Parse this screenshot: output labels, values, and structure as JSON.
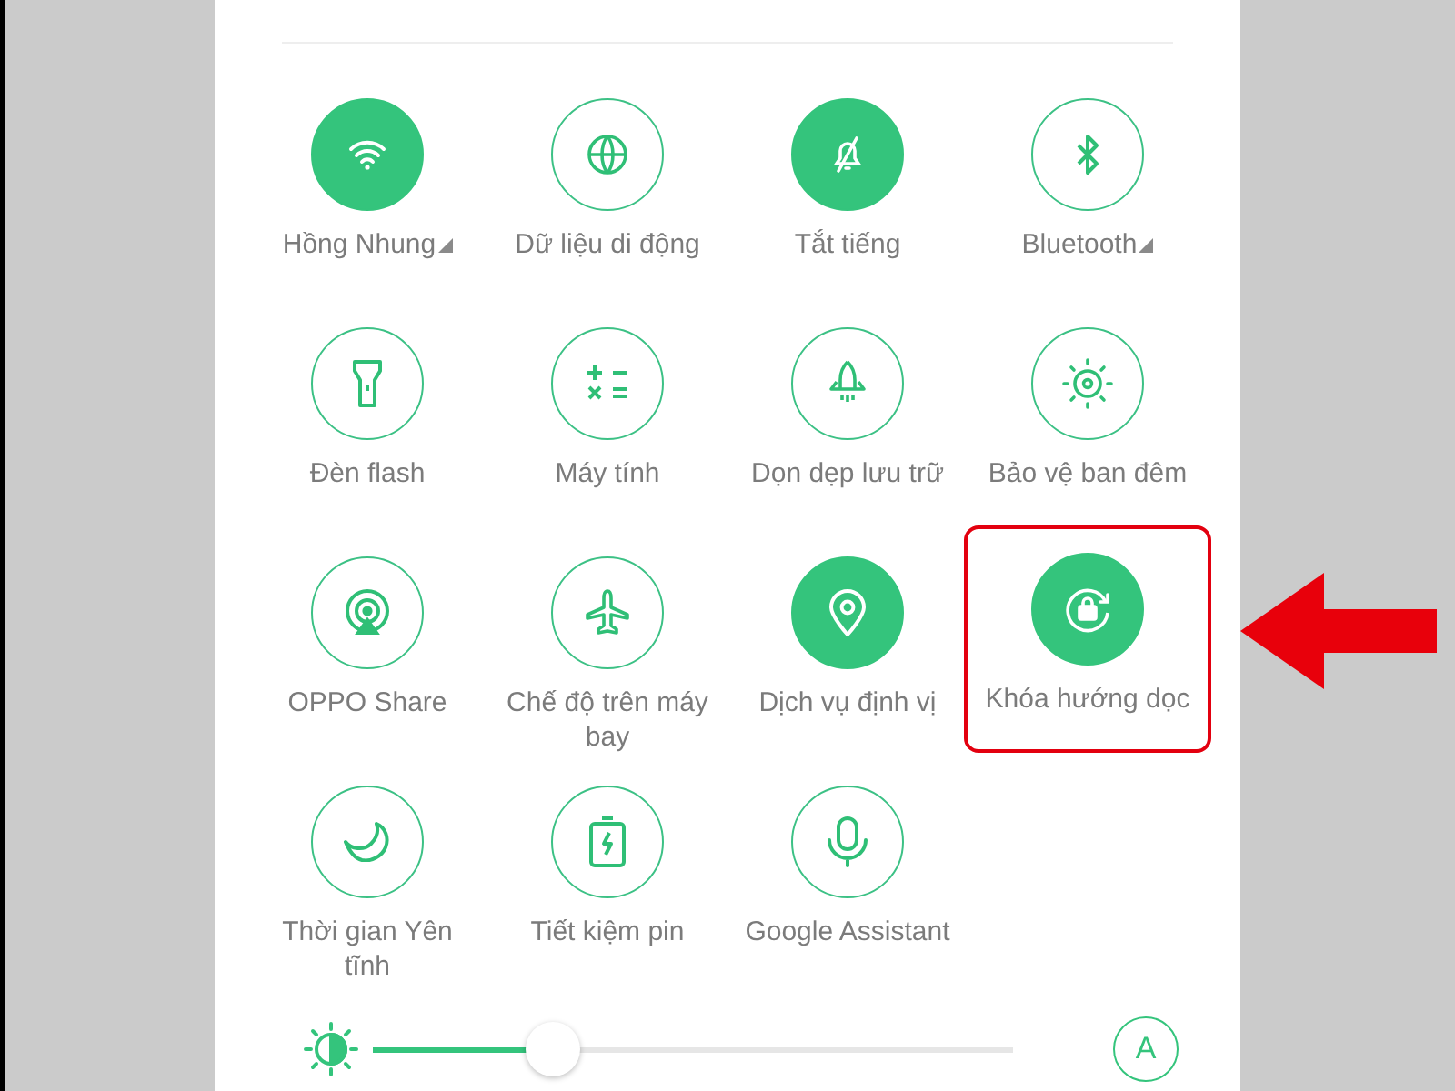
{
  "tiles": [
    {
      "kind": "wifi",
      "label": "Hồng Nhung",
      "on": true,
      "menu": true,
      "highlighted": false
    },
    {
      "kind": "globe",
      "label": "Dữ liệu di động",
      "on": false,
      "menu": false,
      "highlighted": false
    },
    {
      "kind": "mute",
      "label": "Tắt tiếng",
      "on": true,
      "menu": false,
      "highlighted": false
    },
    {
      "kind": "bluetooth",
      "label": "Bluetooth",
      "on": false,
      "menu": true,
      "highlighted": false
    },
    {
      "kind": "flashlight",
      "label": "Đèn flash",
      "on": false,
      "menu": false,
      "highlighted": false
    },
    {
      "kind": "calculator",
      "label": "Máy tính",
      "on": false,
      "menu": false,
      "highlighted": false
    },
    {
      "kind": "rocket",
      "label": "Dọn dẹp lưu trữ",
      "on": false,
      "menu": false,
      "highlighted": false
    },
    {
      "kind": "eye",
      "label": "Bảo vệ ban đêm",
      "on": false,
      "menu": false,
      "highlighted": false
    },
    {
      "kind": "share",
      "label": "OPPO Share",
      "on": false,
      "menu": false,
      "highlighted": false
    },
    {
      "kind": "airplane",
      "label": "Chế độ trên máy bay",
      "on": false,
      "menu": false,
      "highlighted": false
    },
    {
      "kind": "location",
      "label": "Dịch vụ định vị",
      "on": true,
      "menu": false,
      "highlighted": false
    },
    {
      "kind": "rotation",
      "label": "Khóa hướng dọc",
      "on": true,
      "menu": false,
      "highlighted": true
    },
    {
      "kind": "moon",
      "label": "Thời gian Yên tĩnh",
      "on": false,
      "menu": false,
      "highlighted": false
    },
    {
      "kind": "battery",
      "label": "Tiết kiệm pin",
      "on": false,
      "menu": false,
      "highlighted": false
    },
    {
      "kind": "mic",
      "label": "Google Assistant",
      "on": false,
      "menu": false,
      "highlighted": false
    }
  ],
  "brightness": {
    "level": 0.28,
    "auto_label": "A"
  }
}
